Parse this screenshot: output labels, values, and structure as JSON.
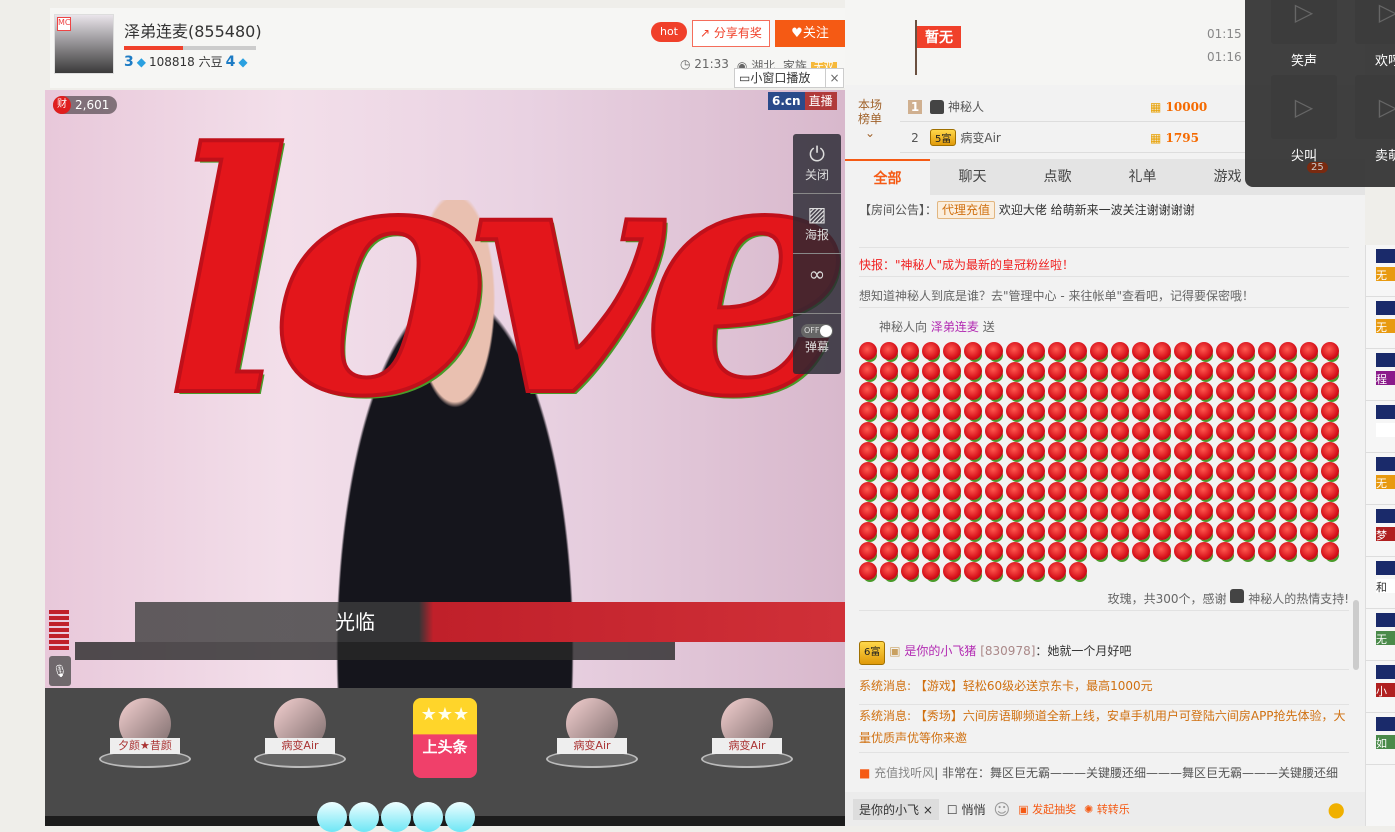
{
  "header": {
    "title": "泽弟连麦(855480)",
    "level_progress": 0.45,
    "level_left": "3",
    "beans": "108818 六豆",
    "level_right": "4",
    "hot": "hot",
    "share": "分享有奖",
    "follow": "关注",
    "time": "21:33",
    "location": "湖北",
    "family": "家族",
    "family_tag": "无双",
    "mini_player": "小窗口播放"
  },
  "video": {
    "wealth": "2,601",
    "wealth_icon": "财",
    "logo": "6.cn",
    "live": "直播",
    "controls": [
      {
        "icon": "power-icon",
        "label": "关闭"
      },
      {
        "icon": "poster-icon",
        "label": "海报"
      },
      {
        "icon": "danmaku-toggle",
        "label": "弹幕",
        "state": "OFF"
      }
    ],
    "overlay_text": "love",
    "banner_text": "光临"
  },
  "seats": [
    {
      "name": "夕颜★昔颜"
    },
    {
      "name": "病变Air"
    },
    {
      "name": "病变Air"
    },
    {
      "name": "病变Air"
    }
  ],
  "headline": "上头条",
  "chat": {
    "flag": "暂无",
    "times": [
      "01:15",
      "01:16"
    ],
    "rank_title": "本场榜单",
    "ranking": [
      {
        "rank": "1",
        "name": "神秘人",
        "score": "10000"
      },
      {
        "rank": "2",
        "badge": "5富",
        "name": "病变Air",
        "score": "1795"
      }
    ],
    "tabs": [
      "全部",
      "聊天",
      "点歌",
      "礼单",
      "游戏"
    ],
    "notice_label": "【房间公告】：",
    "agent_button": "代理充值",
    "notice_text": "欢迎大佬 给萌新来一波关注谢谢谢谢",
    "flash": "快报：\"神秘人\"成为最新的皇冠粉丝啦！",
    "hint": "想知道神秘人到底是谁？去\"管理中心 - 来往帐单\"查看吧，记得要保密哦！",
    "gift_from": "神秘人向",
    "gift_to": "泽弟连麦",
    "gift_send": "送",
    "gift_end": "玫瑰，共300个，感谢",
    "gift_thanks": "神秘人的热情支持!",
    "gift_count": 300,
    "user_badge": "6富",
    "user_name": "是你的小飞猪",
    "user_id": "[830978]",
    "user_msg": "：她就一个月好吧",
    "sys1": "系统消息: 【游戏】轻松60级必送京东卡，最高1000元",
    "sys2": "系统消息: 【秀场】六间房语聊频道全新上线，安卓手机用户可登陆六间房APP抢先体验，大量优质声优等你来邀",
    "ticker_label": "充值找听风",
    "ticker": "| 非常在：舞区巨无霸———关键腰还细———舞区巨无霸———关键腰还细",
    "input_target": "是你的小飞",
    "whisper": "悄悄",
    "lottery": "发起抽奖",
    "wheel": "转转乐"
  },
  "popup": {
    "sounds": [
      "笑声",
      "欢呼",
      "尖叫",
      "卖萌"
    ],
    "car_count": "25"
  },
  "right_strip": [
    "无",
    "无",
    "程",
    "",
    "无",
    "梦",
    "和",
    "无",
    "小",
    "如"
  ]
}
